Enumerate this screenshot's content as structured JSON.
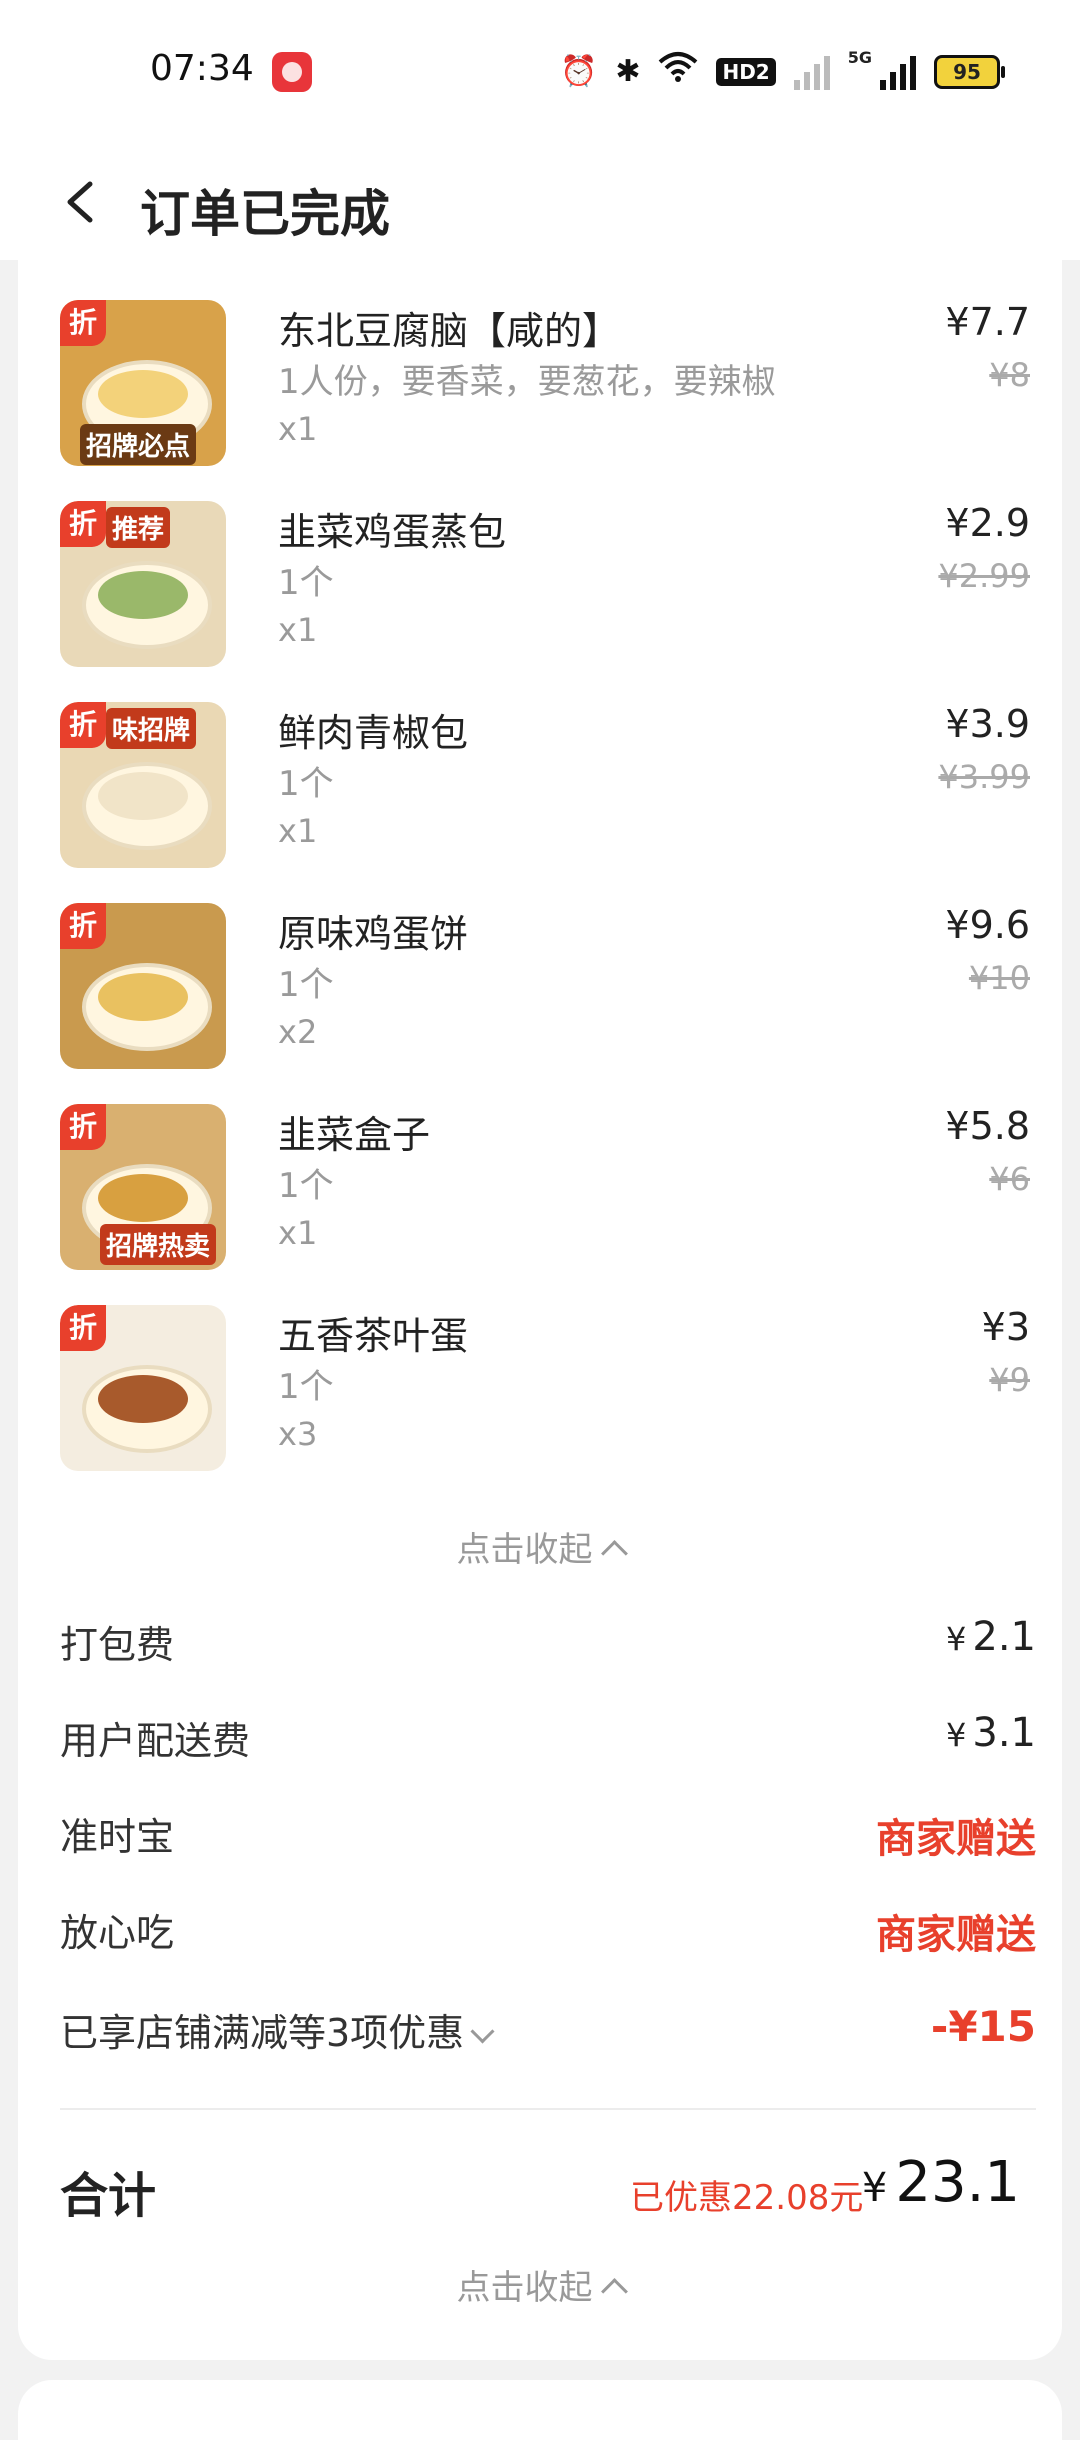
{
  "status_bar": {
    "time": "07:34",
    "network": "5G",
    "hd": "HD2",
    "battery": "95",
    "icons": [
      "alarm-icon",
      "bluetooth-icon",
      "wifi-icon",
      "hd-badge",
      "signal-icon",
      "battery-icon"
    ]
  },
  "header": {
    "title": "订单已完成"
  },
  "items": [
    {
      "name": "东北豆腐脑【咸的】",
      "spec": "1人份，要香菜，要葱花，要辣椒",
      "qty": "x1",
      "price": "¥7.7",
      "original": "¥8",
      "badge": "折",
      "sticker": "招牌必点"
    },
    {
      "name": "韭菜鸡蛋蒸包",
      "spec": "1个",
      "qty": "x1",
      "price": "¥2.9",
      "original": "¥2.99",
      "badge": "折",
      "sticker": "推荐"
    },
    {
      "name": "鲜肉青椒包",
      "spec": "1个",
      "qty": "x1",
      "price": "¥3.9",
      "original": "¥3.99",
      "badge": "折",
      "sticker": "味招牌"
    },
    {
      "name": "原味鸡蛋饼",
      "spec": "1个",
      "qty": "x2",
      "price": "¥9.6",
      "original": "¥10",
      "badge": "折",
      "sticker": ""
    },
    {
      "name": "韭菜盒子",
      "spec": "1个",
      "qty": "x1",
      "price": "¥5.8",
      "original": "¥6",
      "badge": "折",
      "sticker": "招牌热卖"
    },
    {
      "name": "五香茶叶蛋",
      "spec": "1个",
      "qty": "x3",
      "price": "¥3",
      "original": "¥9",
      "badge": "折",
      "sticker": ""
    }
  ],
  "collapse_label": "点击收起",
  "fees": {
    "packing_label": "打包费",
    "packing_yen": "¥",
    "packing_value": "2.1",
    "delivery_label": "用户配送费",
    "delivery_yen": "¥",
    "delivery_value": "3.1",
    "ontime_label": "准时宝",
    "ontime_value": "商家赠送",
    "safe_label": "放心吃",
    "safe_value": "商家赠送",
    "discount_label": "已享店铺满减等3项优惠",
    "discount_value": "-¥15"
  },
  "total": {
    "label": "合计",
    "saved": "已优惠22.08元",
    "yen": "¥",
    "value": "23.1"
  },
  "colors": {
    "accent_red": "#e8402c",
    "badge_red": "#e8402c"
  }
}
